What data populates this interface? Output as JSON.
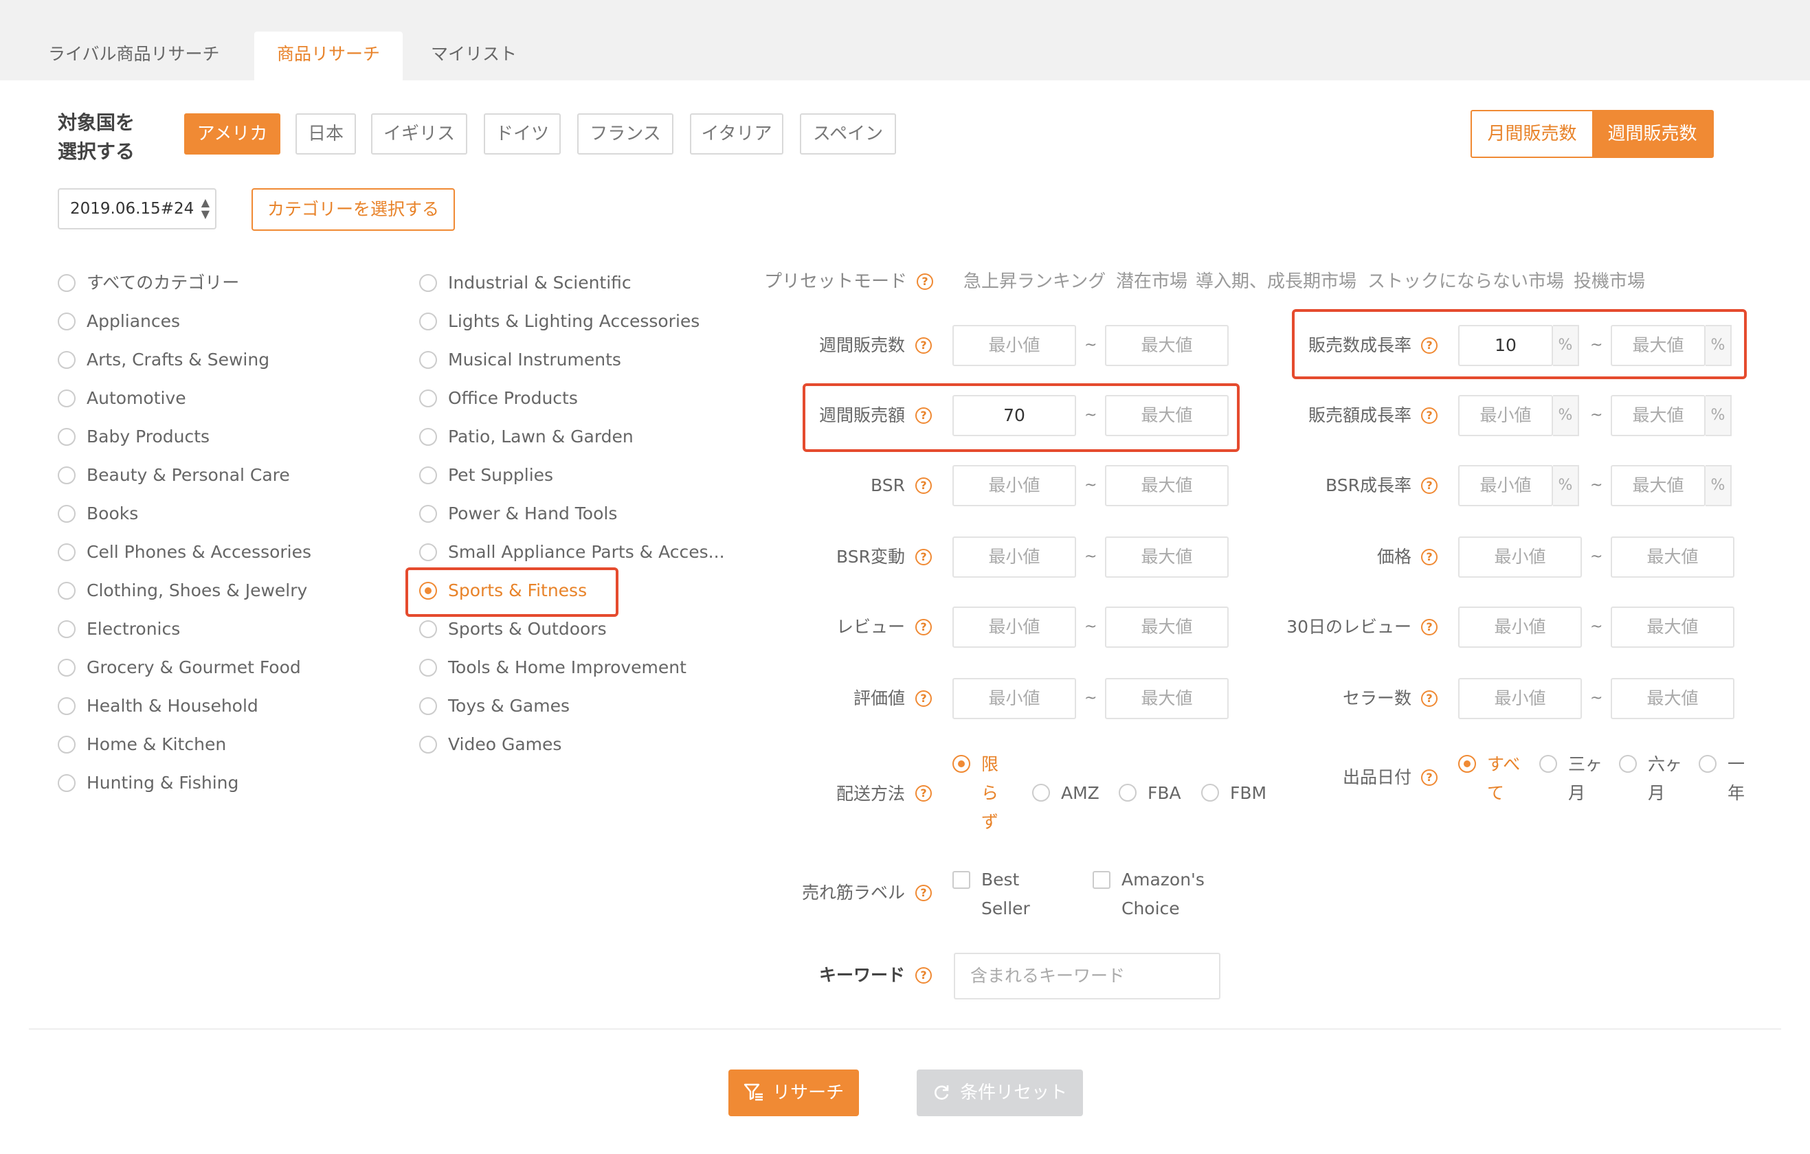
{
  "tabs": [
    {
      "label": "ライバル商品リサーチ"
    },
    {
      "label": "商品リサーチ"
    },
    {
      "label": "マイリスト"
    }
  ],
  "country": {
    "label_line1": "対象国を",
    "label_line2": "選択する",
    "options": [
      "アメリカ",
      "日本",
      "イギリス",
      "ドイツ",
      "フランス",
      "イタリア",
      "スペイン"
    ],
    "selected": "アメリカ"
  },
  "period": {
    "monthly": "月間販売数",
    "weekly": "週間販売数",
    "selected": "週間販売数"
  },
  "date_select": {
    "value": "2019.06.15#24"
  },
  "category_button": "カテゴリーを選択する",
  "categories_left": [
    "すべてのカテゴリー",
    "Appliances",
    "Arts, Crafts & Sewing",
    "Automotive",
    "Baby Products",
    "Beauty & Personal Care",
    "Books",
    "Cell Phones & Accessories",
    "Clothing, Shoes & Jewelry",
    "Electronics",
    "Grocery & Gourmet Food",
    "Health & Household",
    "Home & Kitchen",
    "Hunting & Fishing"
  ],
  "categories_right": [
    "Industrial & Scientific",
    "Lights & Lighting Accessories",
    "Musical Instruments",
    "Office Products",
    "Patio, Lawn & Garden",
    "Pet Supplies",
    "Power & Hand Tools",
    "Small Appliance Parts & Acces...",
    "Sports & Fitness",
    "Sports & Outdoors",
    "Tools & Home Improvement",
    "Toys & Games",
    "Video Games"
  ],
  "selected_category": "Sports & Fitness",
  "preset": {
    "label": "プリセットモード",
    "links": [
      "急上昇ランキング",
      "潜在市場",
      "導入期、成長期市場",
      "ストックにならない市場",
      "投機市場"
    ]
  },
  "placeholders": {
    "min": "最小値",
    "max": "最大値"
  },
  "tilde": "~",
  "percent": "%",
  "filters": {
    "weekly_sales_count": {
      "label": "週間販売数",
      "min": "",
      "max": ""
    },
    "weekly_sales_amount": {
      "label": "週間販売額",
      "min": "70",
      "max": ""
    },
    "bsr": {
      "label": "BSR",
      "min": "",
      "max": ""
    },
    "bsr_change": {
      "label": "BSR変動",
      "min": "",
      "max": ""
    },
    "review": {
      "label": "レビュー",
      "min": "",
      "max": ""
    },
    "rating": {
      "label": "評価値",
      "min": "",
      "max": ""
    },
    "sales_count_growth": {
      "label": "販売数成長率",
      "min": "10",
      "max": ""
    },
    "sales_amount_growth": {
      "label": "販売額成長率",
      "min": "",
      "max": ""
    },
    "bsr_growth": {
      "label": "BSR成長率",
      "min": "",
      "max": ""
    },
    "price": {
      "label": "価格",
      "min": "",
      "max": ""
    },
    "review_30d": {
      "label": "30日のレビュー",
      "min": "",
      "max": ""
    },
    "seller_count": {
      "label": "セラー数",
      "min": "",
      "max": ""
    }
  },
  "shipping": {
    "label": "配送方法",
    "options": [
      {
        "lines": [
          "限",
          "ら",
          "ず"
        ],
        "selected": true
      },
      {
        "lines": [
          "AMZ"
        ],
        "selected": false
      },
      {
        "lines": [
          "FBA"
        ],
        "selected": false
      },
      {
        "lines": [
          "FBM"
        ],
        "selected": false
      }
    ]
  },
  "listing_date": {
    "label": "出品日付",
    "options": [
      {
        "lines": [
          "すべ",
          "て"
        ],
        "selected": true
      },
      {
        "lines": [
          "三ヶ",
          "月"
        ],
        "selected": false
      },
      {
        "lines": [
          "六ヶ",
          "月"
        ],
        "selected": false
      },
      {
        "lines": [
          "一",
          "年"
        ],
        "selected": false
      }
    ]
  },
  "best_label": {
    "label": "売れ筋ラベル",
    "options": [
      {
        "lines": [
          "Best",
          "Seller"
        ]
      },
      {
        "lines": [
          "Amazon's",
          "Choice"
        ]
      }
    ]
  },
  "keyword": {
    "label": "キーワード",
    "placeholder": "含まれるキーワード"
  },
  "buttons": {
    "research": "リサーチ",
    "reset": "条件リセット"
  },
  "colors": {
    "accent": "#f08a34",
    "highlight": "#e54b2e",
    "disabled": "#d6d7d9"
  }
}
